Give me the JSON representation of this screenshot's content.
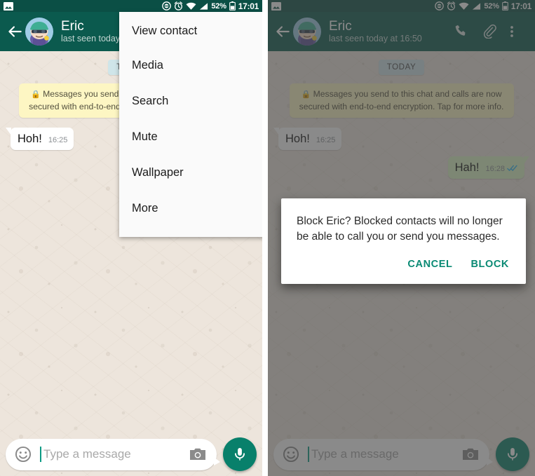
{
  "status_bar": {
    "left_icons": [
      "image-icon"
    ],
    "right_icons": [
      "do-not-disturb-icon",
      "alarm-icon",
      "wifi-icon",
      "signal-icon",
      "battery-icon"
    ],
    "battery_percent": "52%",
    "time": "17:01"
  },
  "app_bar": {
    "back_label": "back-arrow",
    "contact_name": "Eric",
    "status_left": "last seen today",
    "status_right": "last seen today at 16:50",
    "actions": [
      "call-icon",
      "attach-icon",
      "overflow-icon"
    ]
  },
  "chat": {
    "day_divider": "TODAY",
    "encryption_notice": "Messages you send to this chat and calls are now secured with end-to-end encryption. Tap for more info.",
    "encryption_notice_truncated": "Messages you send to this chat and calls are now secured with end-to-end encryption. Tap for more info.",
    "messages": [
      {
        "text": "Hoh!",
        "time": "16:25",
        "direction": "in",
        "ticks": ""
      },
      {
        "text": "Hah!",
        "time": "16:28",
        "direction": "out",
        "ticks": "read-double-check"
      }
    ]
  },
  "composer": {
    "placeholder": "Type a message",
    "emoji_icon": "emoji-icon",
    "camera_icon": "camera-icon",
    "mic_icon": "mic-icon"
  },
  "overflow_menu": {
    "items": [
      {
        "label": "View contact"
      },
      {
        "label": "Media"
      },
      {
        "label": "Search"
      },
      {
        "label": "Mute"
      },
      {
        "label": "Wallpaper"
      },
      {
        "label": "More"
      }
    ]
  },
  "block_dialog": {
    "message": "Block Eric? Blocked contacts will no longer be able to call you or send you messages.",
    "cancel_label": "CANCEL",
    "confirm_label": "BLOCK"
  },
  "colors": {
    "status_bar": "#0B4F45",
    "app_bar": "#0B5A4E",
    "chat_background": "#EDE5DC",
    "incoming_bubble": "#FFFFFF",
    "outgoing_bubble": "#DCF8C6",
    "encryption_notice": "#FDF6C3",
    "day_chip": "#CFE5E9",
    "accent": "#0A8A74",
    "fab": "#08806B",
    "read_tick": "#34B7F1"
  }
}
